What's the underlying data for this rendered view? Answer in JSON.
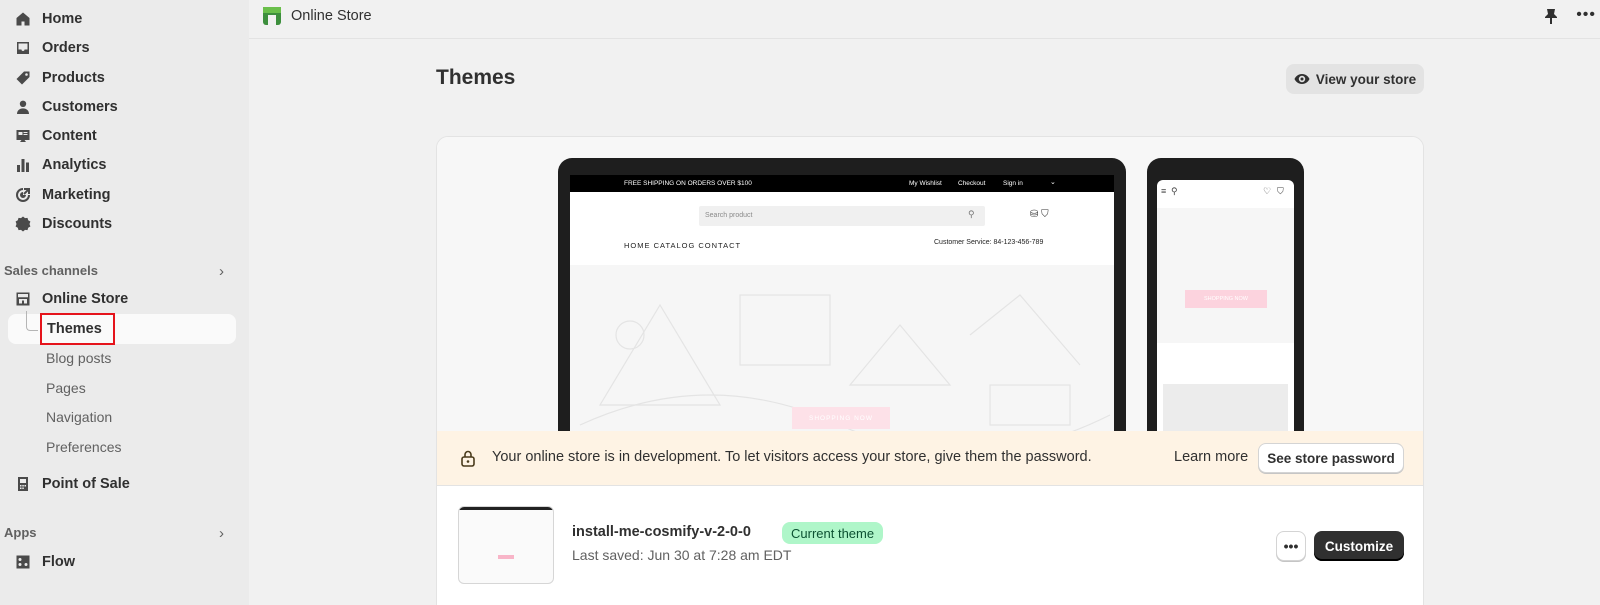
{
  "sidebar": {
    "items": [
      {
        "label": "Home",
        "icon": "home-icon"
      },
      {
        "label": "Orders",
        "icon": "inbox-icon"
      },
      {
        "label": "Products",
        "icon": "tag-icon"
      },
      {
        "label": "Customers",
        "icon": "person-icon"
      },
      {
        "label": "Content",
        "icon": "content-icon"
      },
      {
        "label": "Analytics",
        "icon": "bar-chart-icon"
      },
      {
        "label": "Marketing",
        "icon": "target-icon"
      },
      {
        "label": "Discounts",
        "icon": "discount-icon"
      }
    ],
    "sales_channels_label": "Sales channels",
    "online_store_label": "Online Store",
    "sub_items": {
      "themes": "Themes",
      "blog_posts": "Blog posts",
      "pages": "Pages",
      "navigation": "Navigation",
      "preferences": "Preferences"
    },
    "pos_label": "Point of Sale",
    "apps_label": "Apps",
    "flow_label": "Flow"
  },
  "topbar": {
    "title": "Online Store"
  },
  "main": {
    "page_title": "Themes",
    "view_store_label": "View your store",
    "preview": {
      "laptop": {
        "topbar_shipping": "FREE SHIPPING ON ORDERS OVER $100",
        "wishlist": "My Wishlist",
        "checkout": "Checkout",
        "signin": "Sign in",
        "search_placeholder": "Search product",
        "nav": "HOME   CATALOG   CONTACT",
        "customer_service": "Customer Service: 84-123-456-789",
        "hero_button": "SHOPPING NOW"
      },
      "phone": {
        "hero_button": "SHOPPING NOW"
      }
    },
    "dev_banner": {
      "text": "Your online store is in development. To let visitors access your store, give them the password.",
      "learn_more": "Learn more",
      "see_password": "See store password"
    },
    "theme": {
      "name": "install-me-cosmify-v-2-0-0",
      "badge": "Current theme",
      "last_saved": "Last saved: Jun 30 at 7:28 am EDT",
      "more_label": "•••",
      "customize_label": "Customize"
    }
  },
  "colors": {
    "accent_dark": "#303030",
    "badge_green": "#aff6c9",
    "banner_bg": "#fef3e4",
    "highlight_red": "#e5131b"
  }
}
